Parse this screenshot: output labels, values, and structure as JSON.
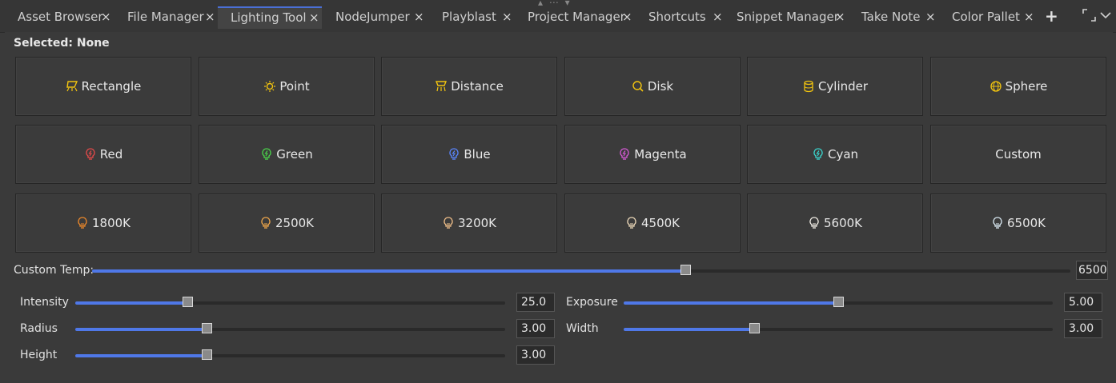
{
  "tabs": [
    {
      "label": "Asset Browser",
      "active": false
    },
    {
      "label": "File Manager",
      "active": false
    },
    {
      "label": "Lighting Tool",
      "active": true
    },
    {
      "label": "NodeJumper",
      "active": false
    },
    {
      "label": "Playblast",
      "active": false
    },
    {
      "label": "Project Manager",
      "active": false
    },
    {
      "label": "Shortcuts",
      "active": false
    },
    {
      "label": "Snippet Manager",
      "active": false
    },
    {
      "label": "Take Note",
      "active": false
    },
    {
      "label": "Color Pallet",
      "active": false
    }
  ],
  "close_glyph": "×",
  "add_glyph": "+",
  "selected_text": "Selected: None",
  "light_types": [
    {
      "label": "Rectangle",
      "icon": "rectangle-light-icon",
      "color": "#f2c40f"
    },
    {
      "label": "Point",
      "icon": "point-light-icon",
      "color": "#f2c40f"
    },
    {
      "label": "Distance",
      "icon": "distance-light-icon",
      "color": "#f2c40f"
    },
    {
      "label": "Disk",
      "icon": "disk-light-icon",
      "color": "#f2c40f"
    },
    {
      "label": "Cylinder",
      "icon": "cylinder-light-icon",
      "color": "#f2c40f"
    },
    {
      "label": "Sphere",
      "icon": "sphere-light-icon",
      "color": "#f2c40f"
    }
  ],
  "light_colors": [
    {
      "label": "Red",
      "icon": "bulb-bolt-icon",
      "color": "#e84a4a"
    },
    {
      "label": "Green",
      "icon": "bulb-bolt-icon",
      "color": "#4ad64a"
    },
    {
      "label": "Blue",
      "icon": "bulb-bolt-icon",
      "color": "#5a86ff"
    },
    {
      "label": "Magenta",
      "icon": "bulb-bolt-icon",
      "color": "#d85ad8"
    },
    {
      "label": "Cyan",
      "icon": "bulb-bolt-icon",
      "color": "#3ad8d0"
    },
    {
      "label": "Custom",
      "icon": "",
      "color": ""
    }
  ],
  "temperatures": [
    {
      "label": "1800K",
      "icon": "bulb-icon",
      "color": "#f08a2a"
    },
    {
      "label": "2500K",
      "icon": "bulb-icon",
      "color": "#f2a84a"
    },
    {
      "label": "3200K",
      "icon": "bulb-icon",
      "color": "#f2c08a"
    },
    {
      "label": "4500K",
      "icon": "bulb-icon",
      "color": "#f0dcbc"
    },
    {
      "label": "5600K",
      "icon": "bulb-icon",
      "color": "#f4f0e8"
    },
    {
      "label": "6500K",
      "icon": "bulb-icon",
      "color": "#dcecf6"
    }
  ],
  "custom_temp": {
    "label": "Custom Temp:",
    "value": "6500",
    "fraction": 0.606
  },
  "sliders": {
    "intensity": {
      "label": "Intensity",
      "value": "25.0",
      "fraction": 0.26
    },
    "exposure": {
      "label": "Exposure",
      "value": "5.00",
      "fraction": 0.5
    },
    "radius": {
      "label": "Radius",
      "value": "3.00",
      "fraction": 0.305
    },
    "width": {
      "label": "Width",
      "value": "3.00",
      "fraction": 0.305
    },
    "height": {
      "label": "Height",
      "value": "3.00",
      "fraction": 0.305
    }
  },
  "accent_color": "#4f78e8"
}
